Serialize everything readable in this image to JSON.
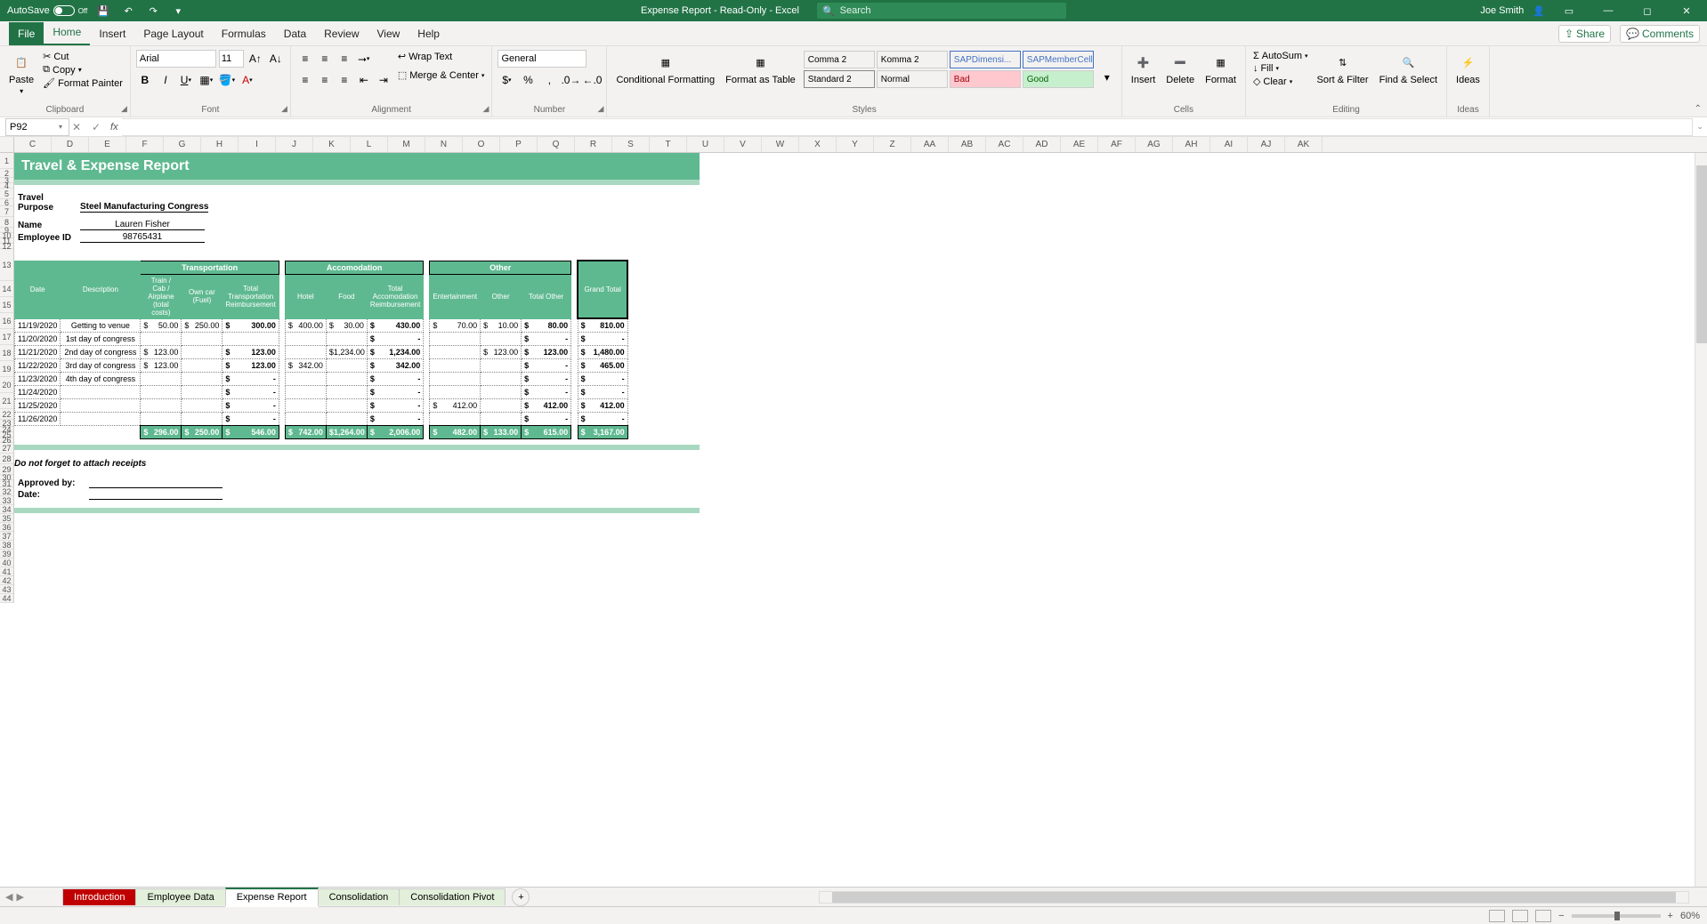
{
  "titlebar": {
    "autosave": "AutoSave",
    "autosave_state": "Off",
    "doc": "Expense Report - Read-Only - Excel",
    "search_placeholder": "Search",
    "user": "Joe Smith"
  },
  "tabs": {
    "file": "File",
    "home": "Home",
    "insert": "Insert",
    "page_layout": "Page Layout",
    "formulas": "Formulas",
    "data": "Data",
    "review": "Review",
    "view": "View",
    "help": "Help",
    "share": "Share",
    "comments": "Comments"
  },
  "clipboard": {
    "paste": "Paste",
    "cut": "Cut",
    "copy": "Copy",
    "fp": "Format Painter",
    "label": "Clipboard"
  },
  "font": {
    "name": "Arial",
    "size": "11",
    "label": "Font"
  },
  "alignment": {
    "wrap": "Wrap Text",
    "merge": "Merge & Center",
    "label": "Alignment"
  },
  "number": {
    "format": "General",
    "label": "Number"
  },
  "styles": {
    "cond": "Conditional Formatting",
    "fat": "Format as Table",
    "c2": "Comma 2",
    "k2": "Komma 2",
    "s2": "Standard 2",
    "normal": "Normal",
    "sap1": "SAPDimensi...",
    "sap2": "SAPMemberCell",
    "bad": "Bad",
    "good": "Good",
    "label": "Styles"
  },
  "cells": {
    "insert": "Insert",
    "delete": "Delete",
    "format": "Format",
    "label": "Cells"
  },
  "editing": {
    "autosum": "AutoSum",
    "fill": "Fill",
    "clear": "Clear",
    "sort": "Sort & Filter",
    "find": "Find & Select",
    "label": "Editing"
  },
  "ideas": {
    "ideas": "Ideas",
    "label": "Ideas"
  },
  "namebox": "P92",
  "report": {
    "title": "Travel & Expense Report",
    "purpose_label": "Travel Purpose",
    "purpose": "Steel Manufacturing Congress",
    "name_label": "Name",
    "name": "Lauren Fisher",
    "emp_label": "Employee ID",
    "emp": "98765431",
    "sections": {
      "trans": "Transportation",
      "accom": "Accomodation",
      "other": "Other"
    },
    "cols": {
      "date": "Date",
      "desc": "Description",
      "train": "Train / Cab / Airplane (total costs)",
      "owncar": "Own car (Fuel)",
      "ttrans": "Total Transportation Reimbursement",
      "hotel": "Hotel",
      "food": "Food",
      "taccom": "Total Accomodation Reimbursement",
      "ent": "Entertainment",
      "oth": "Other",
      "tother": "Total Other",
      "grand": "Grand Total"
    },
    "rows": [
      {
        "date": "11/19/2020",
        "desc": "Getting to venue",
        "train": "50.00",
        "own": "250.00",
        "ttrans": "300.00",
        "hotel": "400.00",
        "food": "30.00",
        "taccom": "430.00",
        "ent": "70.00",
        "oth": "10.00",
        "tother": "80.00",
        "grand": "810.00"
      },
      {
        "date": "11/20/2020",
        "desc": "1st day of congress",
        "train": "",
        "own": "",
        "ttrans": "",
        "hotel": "",
        "food": "",
        "taccom": "-",
        "ent": "",
        "oth": "",
        "tother": "-",
        "grand": "-"
      },
      {
        "date": "11/21/2020",
        "desc": "2nd day of congress",
        "train": "123.00",
        "own": "",
        "ttrans": "123.00",
        "hotel": "",
        "food": "1,234.00",
        "taccom": "1,234.00",
        "ent": "",
        "oth": "123.00",
        "tother": "123.00",
        "grand": "1,480.00"
      },
      {
        "date": "11/22/2020",
        "desc": "3rd day of congress",
        "train": "123.00",
        "own": "",
        "ttrans": "123.00",
        "hotel": "342.00",
        "food": "",
        "taccom": "342.00",
        "ent": "",
        "oth": "",
        "tother": "-",
        "grand": "465.00"
      },
      {
        "date": "11/23/2020",
        "desc": "4th day of congress",
        "train": "",
        "own": "",
        "ttrans": "-",
        "hotel": "",
        "food": "",
        "taccom": "-",
        "ent": "",
        "oth": "",
        "tother": "-",
        "grand": "-"
      },
      {
        "date": "11/24/2020",
        "desc": "",
        "train": "",
        "own": "",
        "ttrans": "-",
        "hotel": "",
        "food": "",
        "taccom": "-",
        "ent": "",
        "oth": "",
        "tother": "-",
        "grand": "-"
      },
      {
        "date": "11/25/2020",
        "desc": "",
        "train": "",
        "own": "",
        "ttrans": "-",
        "hotel": "",
        "food": "",
        "taccom": "-",
        "ent": "412.00",
        "oth": "",
        "tother": "412.00",
        "grand": "412.00"
      },
      {
        "date": "11/26/2020",
        "desc": "",
        "train": "",
        "own": "",
        "ttrans": "-",
        "hotel": "",
        "food": "",
        "taccom": "-",
        "ent": "",
        "oth": "",
        "tother": "-",
        "grand": "-"
      }
    ],
    "totals": {
      "train": "296.00",
      "own": "250.00",
      "ttrans": "546.00",
      "hotel": "742.00",
      "food": "1,264.00",
      "taccom": "2,006.00",
      "ent": "482.00",
      "oth": "133.00",
      "tother": "615.00",
      "grand": "3,167.00"
    },
    "note": "Do not forget to attach receipts",
    "approved": "Approved by:",
    "date_label": "Date:"
  },
  "sheets": {
    "s1": "Introduction",
    "s2": "Employee Data",
    "s3": "Expense Report",
    "s4": "Consolidation",
    "s5": "Consolidation Pivot"
  },
  "status": {
    "zoom": "60%"
  },
  "columns": [
    "C",
    "D",
    "E",
    "F",
    "G",
    "H",
    "I",
    "J",
    "K",
    "L",
    "M",
    "N",
    "O",
    "P",
    "Q",
    "R",
    "S",
    "T",
    "U",
    "V",
    "W",
    "X",
    "Y",
    "Z",
    "AA",
    "AB",
    "AC",
    "AD",
    "AE",
    "AF",
    "AG",
    "AH",
    "AI",
    "AJ",
    "AK"
  ]
}
